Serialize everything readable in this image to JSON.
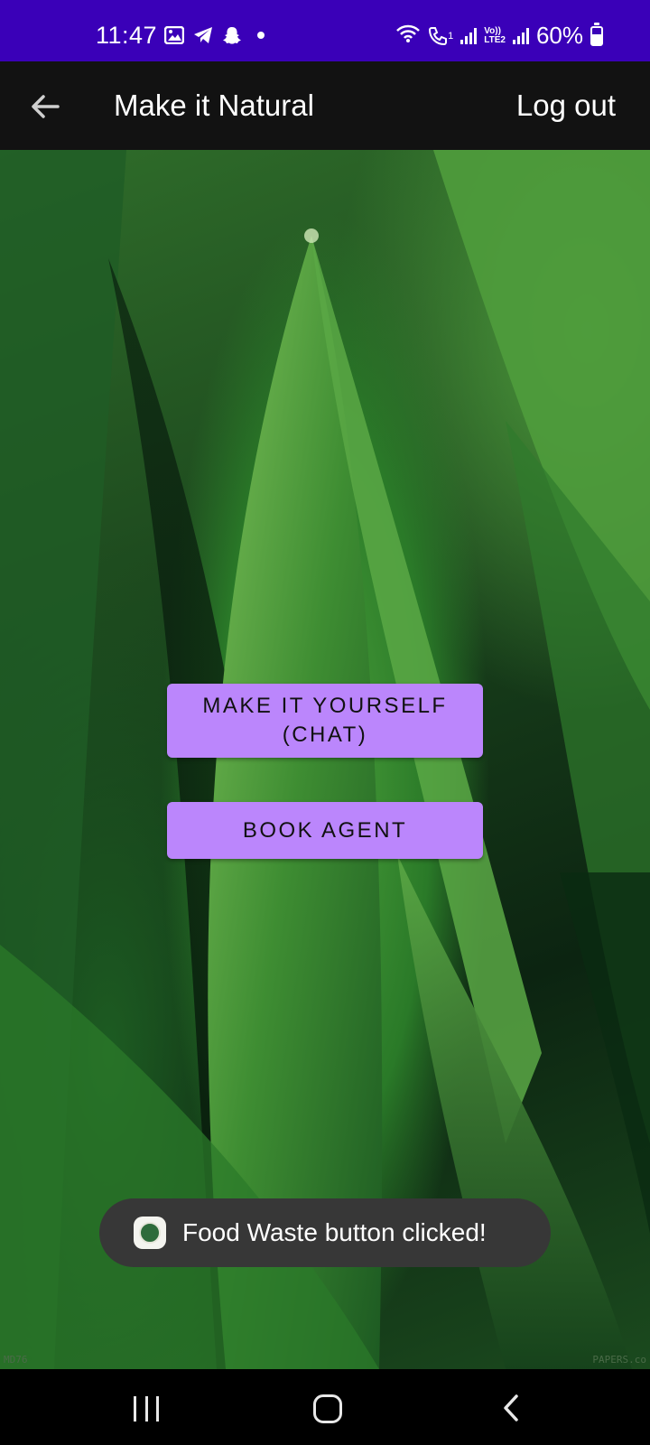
{
  "status_bar": {
    "time": "11:47",
    "left_icons": [
      "gallery-icon",
      "telegram-icon",
      "snapchat-icon",
      "dot-icon"
    ],
    "right_icons": [
      "wifi-icon",
      "volte-call-icon",
      "signal-icon",
      "volte-lte2-icon",
      "signal-icon",
      "battery-icon"
    ],
    "sim1_label": "1",
    "volte_label": "Vo))",
    "lte_label": "LTE2",
    "battery_percent": "60%",
    "battery_level": 0.6
  },
  "app_bar": {
    "title": "Make it Natural",
    "logout_label": "Log out",
    "back_icon": "arrow-left-icon"
  },
  "main": {
    "make_yourself_label": "MAKE IT YOURSELF\n(CHAT)",
    "book_agent_label": "BOOK AGENT",
    "button_color": "#bb86fc",
    "watermark_left": "MD76",
    "watermark_right": "PAPERS.co"
  },
  "toast": {
    "message": "Food Waste button clicked!",
    "icon": "app-logo-icon"
  },
  "nav_bar": {
    "icons": [
      "recent-apps-icon",
      "home-icon",
      "back-icon"
    ]
  },
  "colors": {
    "status_bar": "#3a00b8",
    "app_bar": "#121212",
    "toast_bg": "#373737"
  }
}
